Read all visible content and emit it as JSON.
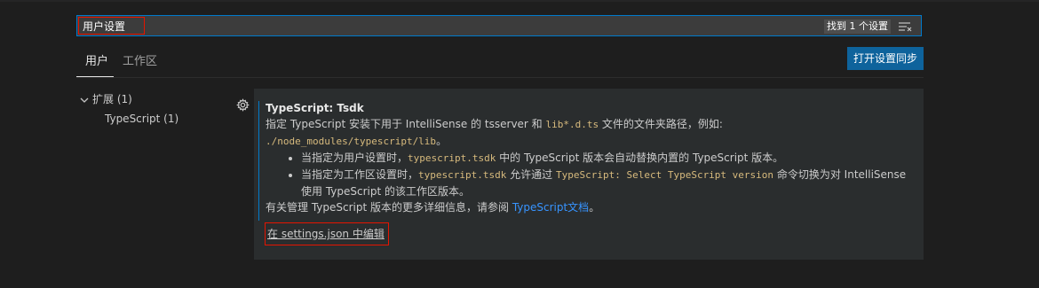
{
  "search": {
    "value": "用户设置",
    "result_count": "找到 1 个设置",
    "filter_icon": "clear-filter-icon"
  },
  "tabs": [
    {
      "label": "用户",
      "active": true
    },
    {
      "label": "工作区",
      "active": false
    }
  ],
  "sync_button": "打开设置同步",
  "tree": {
    "extensions_label": "扩展 (1)",
    "typescript_label": "TypeScript (1)"
  },
  "setting": {
    "category": "TypeScript: ",
    "name": "Tsdk",
    "desc_prefix": "指定 TypeScript 安装下用于 IntelliSense 的 tsserver 和 ",
    "desc_code": "lib*.d.ts",
    "desc_suffix": " 文件的文件夹路径，例如:",
    "example_path": "./node_modules/typescript/lib",
    "example_end": "。",
    "bullet1_prefix": "当指定为用户设置时，",
    "bullet1_code": "typescript.tsdk",
    "bullet1_suffix": " 中的 TypeScript 版本会自动替换内置的 TypeScript 版本。",
    "bullet2_prefix": "当指定为工作区设置时，",
    "bullet2_code": "typescript.tsdk",
    "bullet2_middle": " 允许通过 ",
    "bullet2_command": "TypeScript: Select TypeScript version",
    "bullet2_suffix": " 命令切换为对 IntelliSense 使用 TypeScript 的该工作区版本。",
    "more_prefix": "有关管理 TypeScript 版本的更多详细信息，请参阅 ",
    "more_link": "TypeScript文档",
    "more_suffix": "。",
    "edit_link": "在 settings.json 中编辑"
  },
  "colors": {
    "background": "#1e1e1e",
    "accent": "#007acc",
    "button": "#0e639c",
    "highlight_border": "#e51400",
    "code": "#d7ba7d",
    "link": "#3794ff"
  }
}
